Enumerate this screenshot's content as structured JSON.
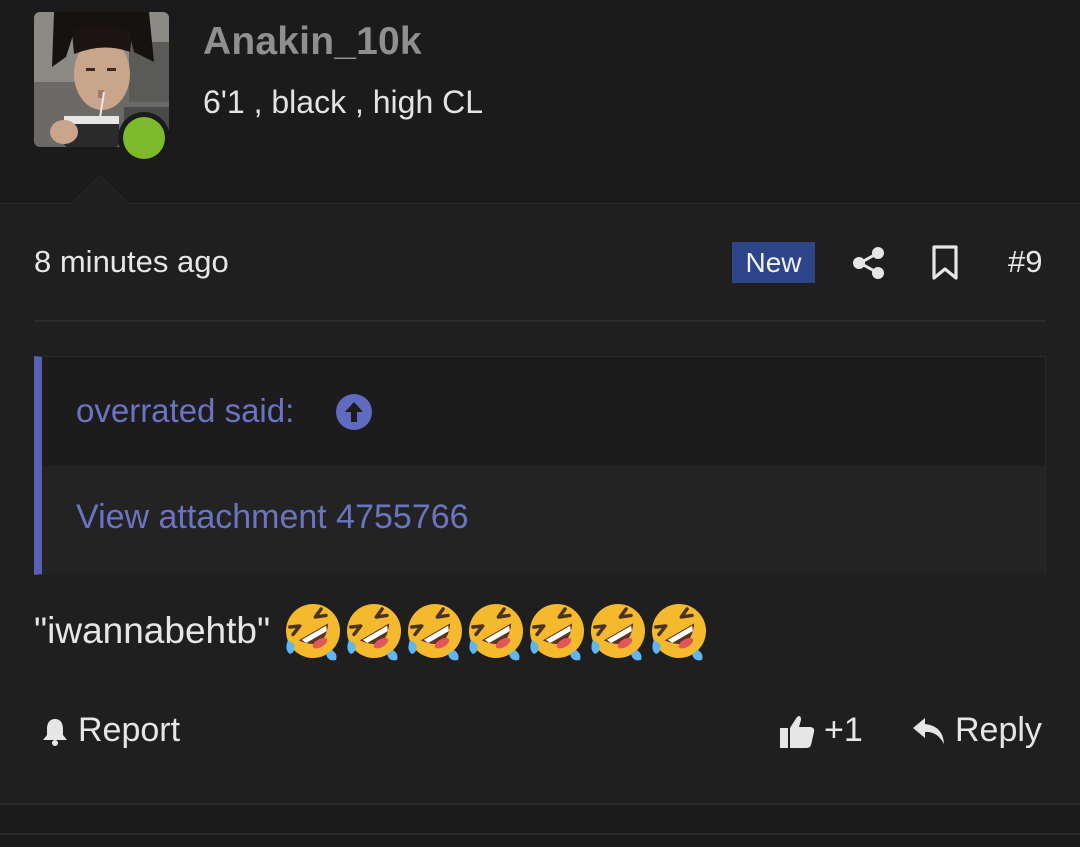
{
  "user": {
    "username": "Anakin_10k",
    "title": "6'1 , black , high CL",
    "online": true,
    "online_color": "#7dbb2c"
  },
  "post": {
    "timestamp": "8 minutes ago",
    "badge": "New",
    "badge_color": "#2d4588",
    "number": "#9",
    "icons": [
      "share-icon",
      "bookmark-icon"
    ],
    "quote": {
      "author_label": "overrated said:",
      "attachment_label": "View attachment 4755766",
      "accent_color": "#5661b3"
    },
    "message": "\"iwannabehtb\"",
    "emoji": [
      "rofl",
      "rofl",
      "rofl",
      "rofl",
      "rofl",
      "rofl",
      "rofl"
    ],
    "actions": {
      "report_label": "Report",
      "like_label": "+1",
      "reply_label": "Reply"
    }
  }
}
